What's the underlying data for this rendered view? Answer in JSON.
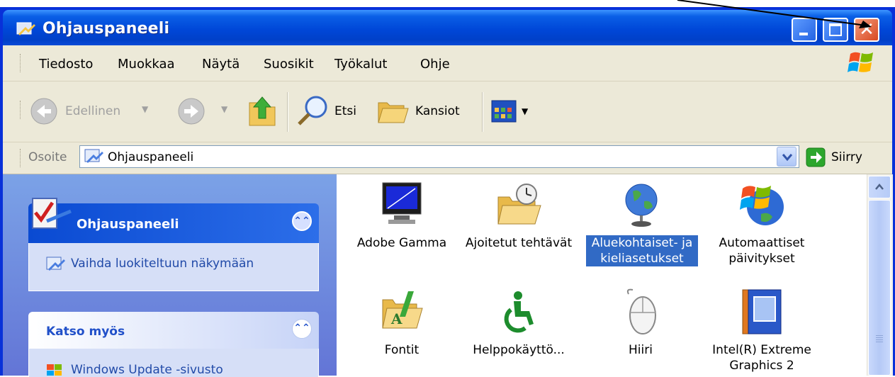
{
  "window": {
    "title": "Ohjauspaneeli"
  },
  "menu": {
    "items": [
      {
        "label": "Tiedosto"
      },
      {
        "label": "Muokkaa"
      },
      {
        "label": "Näytä"
      },
      {
        "label": "Suosikit"
      },
      {
        "label": "Työkalut"
      },
      {
        "label": "Ohje"
      }
    ]
  },
  "toolbar": {
    "back_label": "Edellinen",
    "search_label": "Etsi",
    "folders_label": "Kansiot"
  },
  "address": {
    "label": "Osoite",
    "value": "Ohjauspaneeli",
    "go_label": "Siirry"
  },
  "task_panel": {
    "header": "Ohjauspaneeli",
    "link": "Vaihda luokiteltuun näkymään",
    "see_also_header": "Katso myös",
    "see_also_link": "Windows Update -sivusto"
  },
  "items": [
    {
      "label": "Adobe Gamma",
      "icon": "monitor-icon"
    },
    {
      "label": "Ajoitetut tehtävät",
      "icon": "scheduled-tasks-icon"
    },
    {
      "label": "Aluekohtaiset- ja kieliasetukset",
      "icon": "globe-icon",
      "selected": true
    },
    {
      "label": "Automaattiset päivitykset",
      "icon": "windows-update-icon"
    },
    {
      "label": "Fontit",
      "icon": "fonts-folder-icon"
    },
    {
      "label": "Helppokäyttö...",
      "icon": "accessibility-icon"
    },
    {
      "label": "Hiiri",
      "icon": "mouse-icon"
    },
    {
      "label": "Intel(R) Extreme Graphics 2",
      "icon": "intel-graphics-icon"
    }
  ],
  "colors": {
    "titlebar": "#0a5fe6",
    "selection": "#316ac5",
    "task_header": "#0a4ad2",
    "panel_bg": "#6f8fe0",
    "close_button": "#d84a20"
  }
}
